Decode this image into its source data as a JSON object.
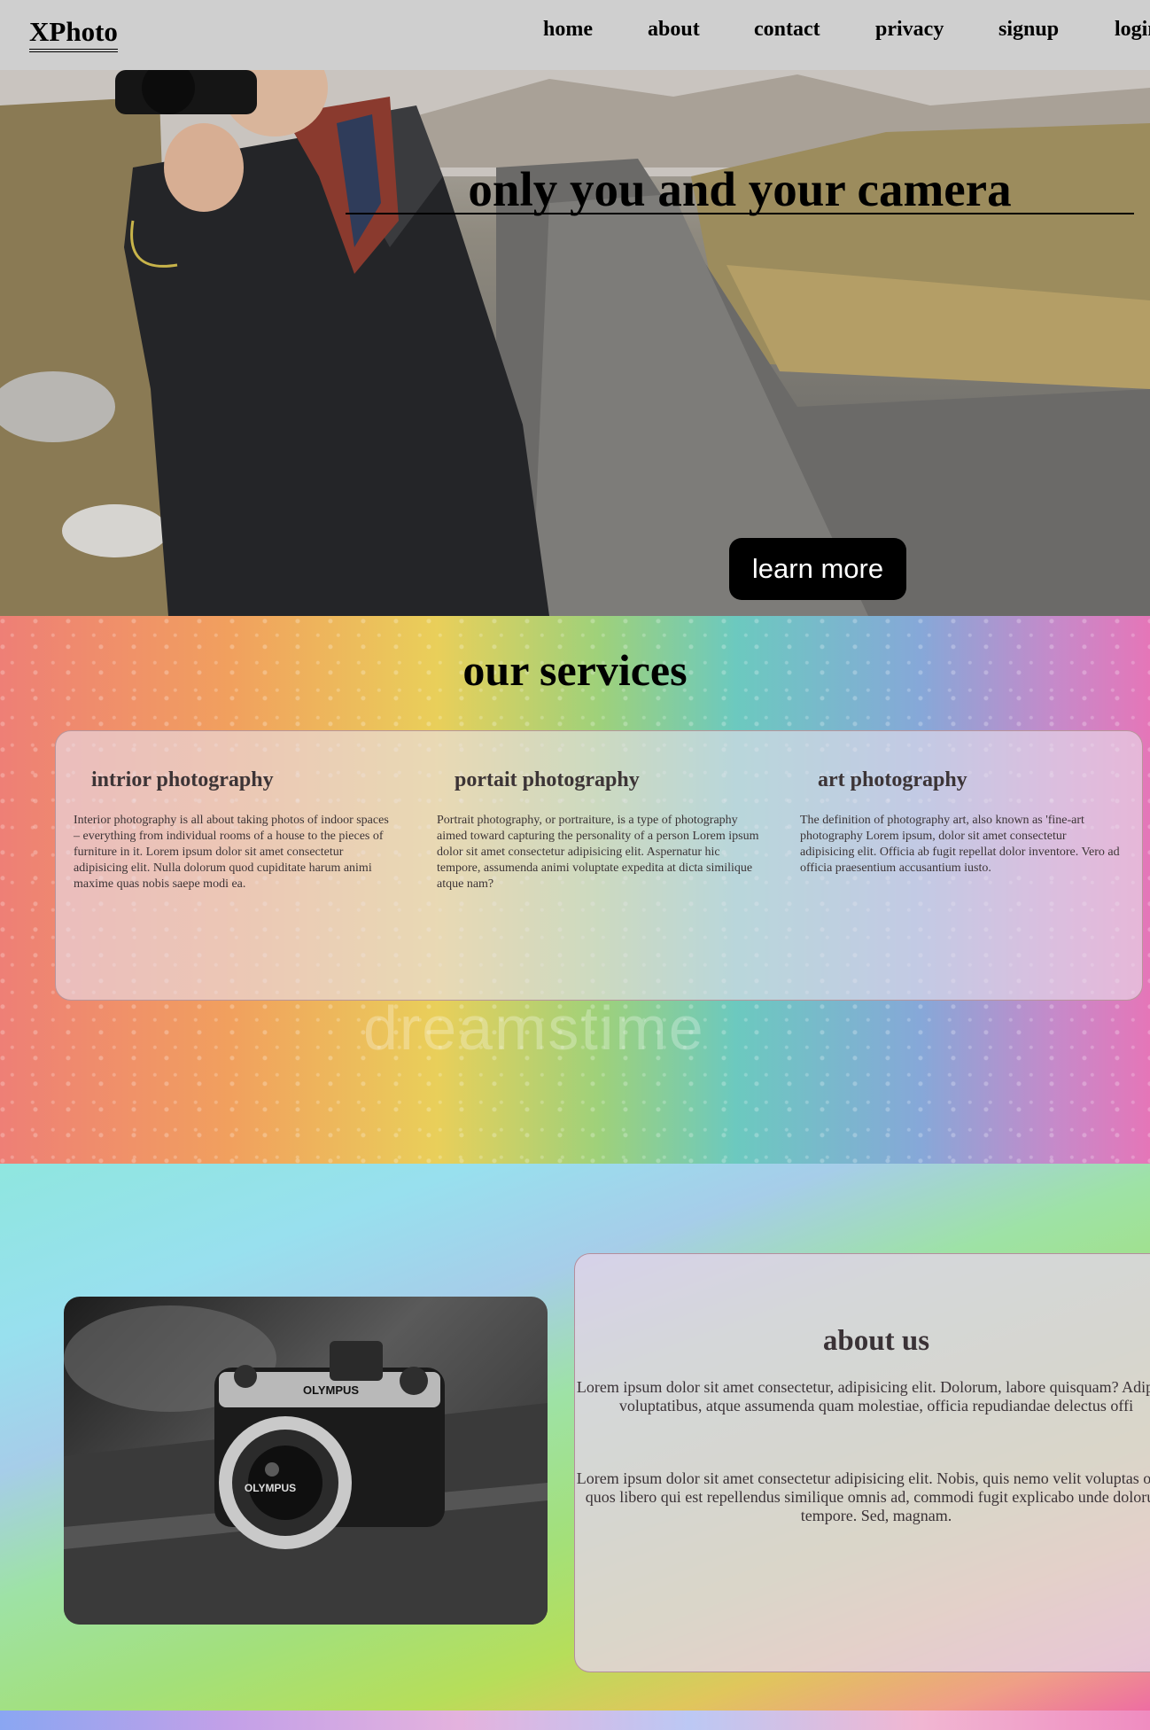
{
  "nav": {
    "logo": "XPhoto",
    "links": [
      "home",
      "about",
      "contact",
      "privacy",
      "signup",
      "login"
    ]
  },
  "hero": {
    "title": "only you and your camera",
    "button_label": "learn more"
  },
  "services": {
    "title": "our services",
    "watermark": "dreamstime",
    "items": [
      {
        "title": "intrior photography",
        "text": "Interior photography is all about taking photos of indoor spaces – everything from individual rooms of a house to the pieces of furniture in it. Lorem ipsum dolor sit amet consectetur adipisicing elit. Nulla dolorum quod cupiditate harum animi maxime quas nobis saepe modi ea."
      },
      {
        "title": "portait photography",
        "text": "Portrait photography, or portraiture, is a type of photography aimed toward capturing the personality of a person Lorem ipsum dolor sit amet consectetur adipisicing elit. Aspernatur hic tempore, assumenda animi voluptate expedita at dicta similique atque nam?"
      },
      {
        "title": "art photography",
        "text": "The definition of photography art, also known as 'fine-art photography Lorem ipsum, dolor sit amet consectetur adipisicing elit. Officia ab fugit repellat dolor inventore. Vero ad officia praesentium accusantium iusto."
      }
    ]
  },
  "about": {
    "title": "about us",
    "camera_brand": "OLYMPUS",
    "paragraphs": [
      "Lorem ipsum dolor sit amet consectetur, adipisicing elit. Dolorum, labore quisquam? Adipisci voluptatibus, atque assumenda quam molestiae, officia repudiandae delectus offi",
      "Lorem ipsum dolor sit amet consectetur adipisicing elit. Nobis, quis nemo velit voluptas optio quos libero qui est repellendus similique omnis ad, commodi fugit explicabo unde dolorum tempore. Sed, magnam."
    ]
  }
}
